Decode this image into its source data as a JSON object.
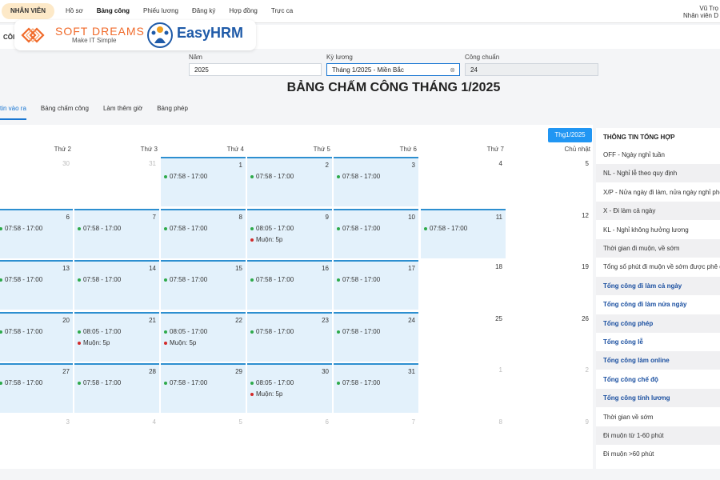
{
  "topbar": {
    "role": "NHÂN VIÊN",
    "nav": [
      {
        "label": "Hồ sơ",
        "active": false
      },
      {
        "label": "Bảng công",
        "active": true
      },
      {
        "label": "Phiếu lương",
        "active": false
      },
      {
        "label": "Đăng ký",
        "active": false
      },
      {
        "label": "Hợp đồng",
        "active": false
      },
      {
        "label": "Trực ca",
        "active": false
      }
    ],
    "user_name": "Vũ Trọ",
    "user_role": "Nhân viên D"
  },
  "subbar_title": "CÔI",
  "logos": {
    "softdreams_name": "SOFT DREAMS",
    "softdreams_tagline": "Make IT Simple",
    "easyhrm_name": "EasyHRM"
  },
  "filters": {
    "year_label": "Năm",
    "year_value": "2025",
    "period_label": "Kỳ lương",
    "period_value": "Tháng 1/2025 - Miền Bắc",
    "standard_label": "Công chuẩn",
    "standard_value": "24"
  },
  "page_title": "BẢNG CHẤM CÔNG THÁNG 1/2025",
  "tabs": [
    {
      "label": "tin vào ra",
      "active": true
    },
    {
      "label": "Bảng chấm công",
      "active": false
    },
    {
      "label": "Làm thêm giờ",
      "active": false
    },
    {
      "label": "Bảng phép",
      "active": false
    }
  ],
  "calendar": {
    "month_button": "Thg1/2025",
    "weekdays": [
      "Thứ 2",
      "Thứ 3",
      "Thứ 4",
      "Thứ 5",
      "Thứ 6",
      "Thứ 7",
      "Chủ nhật"
    ],
    "weeks": [
      [
        {
          "day": "",
          "other": true,
          "entries": []
        },
        {
          "day": "30",
          "other": true,
          "entries": []
        },
        {
          "day": "31",
          "other": true,
          "entries": []
        },
        {
          "day": "1",
          "work": true,
          "entries": [
            {
              "text": "07:58 - 17:00",
              "color": "green"
            }
          ]
        },
        {
          "day": "2",
          "work": true,
          "entries": [
            {
              "text": "07:58 - 17:00",
              "color": "green"
            }
          ]
        },
        {
          "day": "3",
          "work": true,
          "entries": [
            {
              "text": "07:58 - 17:00",
              "color": "green"
            }
          ]
        },
        {
          "day": "4",
          "entries": []
        },
        {
          "day": "5",
          "entries": []
        }
      ],
      [
        {
          "day": "6",
          "work": true,
          "entries": [
            {
              "text": "07:58 - 17:00",
              "color": "green"
            }
          ]
        },
        {
          "day": "7",
          "work": true,
          "entries": [
            {
              "text": "07:58 - 17:00",
              "color": "green"
            }
          ]
        },
        {
          "day": "8",
          "work": true,
          "entries": [
            {
              "text": "07:58 - 17:00",
              "color": "green"
            }
          ]
        },
        {
          "day": "9",
          "work": true,
          "entries": [
            {
              "text": "08:05 - 17:00",
              "color": "green"
            },
            {
              "text": "Muộn: 5p",
              "color": "red"
            }
          ]
        },
        {
          "day": "10",
          "work": true,
          "entries": [
            {
              "text": "07:58 - 17:00",
              "color": "green"
            }
          ]
        },
        {
          "day": "11",
          "work": true,
          "entries": [
            {
              "text": "07:58 - 17:00",
              "color": "green"
            }
          ]
        },
        {
          "day": "12",
          "entries": []
        }
      ],
      [
        {
          "day": "13",
          "work": true,
          "entries": [
            {
              "text": "07:58 - 17:00",
              "color": "green"
            }
          ]
        },
        {
          "day": "14",
          "work": true,
          "entries": [
            {
              "text": "07:58 - 17:00",
              "color": "green"
            }
          ]
        },
        {
          "day": "15",
          "work": true,
          "entries": [
            {
              "text": "07:58 - 17:00",
              "color": "green"
            }
          ]
        },
        {
          "day": "16",
          "work": true,
          "entries": [
            {
              "text": "07:58 - 17:00",
              "color": "green"
            }
          ]
        },
        {
          "day": "17",
          "work": true,
          "entries": [
            {
              "text": "07:58 - 17:00",
              "color": "green"
            }
          ]
        },
        {
          "day": "18",
          "entries": []
        },
        {
          "day": "19",
          "entries": []
        }
      ],
      [
        {
          "day": "20",
          "work": true,
          "entries": [
            {
              "text": "07:58 - 17:00",
              "color": "green"
            }
          ]
        },
        {
          "day": "21",
          "work": true,
          "entries": [
            {
              "text": "08:05 - 17:00",
              "color": "green"
            },
            {
              "text": "Muộn: 5p",
              "color": "red"
            }
          ]
        },
        {
          "day": "22",
          "work": true,
          "entries": [
            {
              "text": "08:05 - 17:00",
              "color": "green"
            },
            {
              "text": "Muộn: 5p",
              "color": "red"
            }
          ]
        },
        {
          "day": "23",
          "work": true,
          "entries": [
            {
              "text": "07:58 - 17:00",
              "color": "green"
            }
          ]
        },
        {
          "day": "24",
          "work": true,
          "entries": [
            {
              "text": "07:58 - 17:00",
              "color": "green"
            }
          ]
        },
        {
          "day": "25",
          "entries": []
        },
        {
          "day": "26",
          "entries": []
        }
      ],
      [
        {
          "day": "27",
          "work": true,
          "entries": [
            {
              "text": "07:58 - 17:00",
              "color": "green"
            }
          ]
        },
        {
          "day": "28",
          "work": true,
          "entries": [
            {
              "text": "07:58 - 17:00",
              "color": "green"
            }
          ]
        },
        {
          "day": "29",
          "work": true,
          "entries": [
            {
              "text": "07:58 - 17:00",
              "color": "green"
            }
          ]
        },
        {
          "day": "30",
          "work": true,
          "entries": [
            {
              "text": "08:05 - 17:00",
              "color": "green"
            },
            {
              "text": "Muộn: 5p",
              "color": "red"
            }
          ]
        },
        {
          "day": "31",
          "work": true,
          "entries": [
            {
              "text": "07:58 - 17:00",
              "color": "green"
            }
          ]
        },
        {
          "day": "1",
          "other": true,
          "entries": []
        },
        {
          "day": "2",
          "other": true,
          "entries": []
        }
      ],
      [
        {
          "day": "3",
          "other": true,
          "entries": []
        },
        {
          "day": "4",
          "other": true,
          "entries": []
        },
        {
          "day": "5",
          "other": true,
          "entries": []
        },
        {
          "day": "6",
          "other": true,
          "entries": []
        },
        {
          "day": "7",
          "other": true,
          "entries": []
        },
        {
          "day": "8",
          "other": true,
          "entries": []
        },
        {
          "day": "9",
          "other": true,
          "entries": []
        }
      ]
    ]
  },
  "summary": {
    "title": "THÔNG TIN TỔNG HỢP",
    "items": [
      {
        "label": "OFF - Ngày nghỉ tuần",
        "bold": false
      },
      {
        "label": "NL - Nghỉ lễ theo quy định",
        "bold": false
      },
      {
        "label": "X/P - Nửa ngày đi làm, nửa ngày nghỉ phép",
        "bold": false
      },
      {
        "label": "X - Đi làm cả ngày",
        "bold": false
      },
      {
        "label": "KL - Nghỉ không hưởng lương",
        "bold": false
      },
      {
        "label": "Thời gian đi muộn, về sớm",
        "bold": false
      },
      {
        "label": "Tổng số phút đi muộn về sớm được phê duyệt",
        "bold": false
      },
      {
        "label": "Tổng công đi làm cả ngày",
        "bold": true
      },
      {
        "label": "Tổng công đi làm nửa ngày",
        "bold": true
      },
      {
        "label": "Tổng công phép",
        "bold": true
      },
      {
        "label": "Tổng công lễ",
        "bold": true
      },
      {
        "label": "Tổng công làm online",
        "bold": true
      },
      {
        "label": "Tổng công chế độ",
        "bold": true
      },
      {
        "label": "Tổng công tính lương",
        "bold": true
      },
      {
        "label": "Thời gian về sớm",
        "bold": false
      },
      {
        "label": "Đi muộn từ 1-60 phút",
        "bold": false
      },
      {
        "label": "Đi muộn >60 phút",
        "bold": false
      }
    ]
  },
  "colors": {
    "accent": "#2196f3",
    "work_day_bg": "#e3f1fb",
    "ok_dot": "#2eaa4a",
    "late_dot": "#d22a2a",
    "brand_orange": "#f06a2a",
    "brand_blue": "#1e5aa8"
  }
}
